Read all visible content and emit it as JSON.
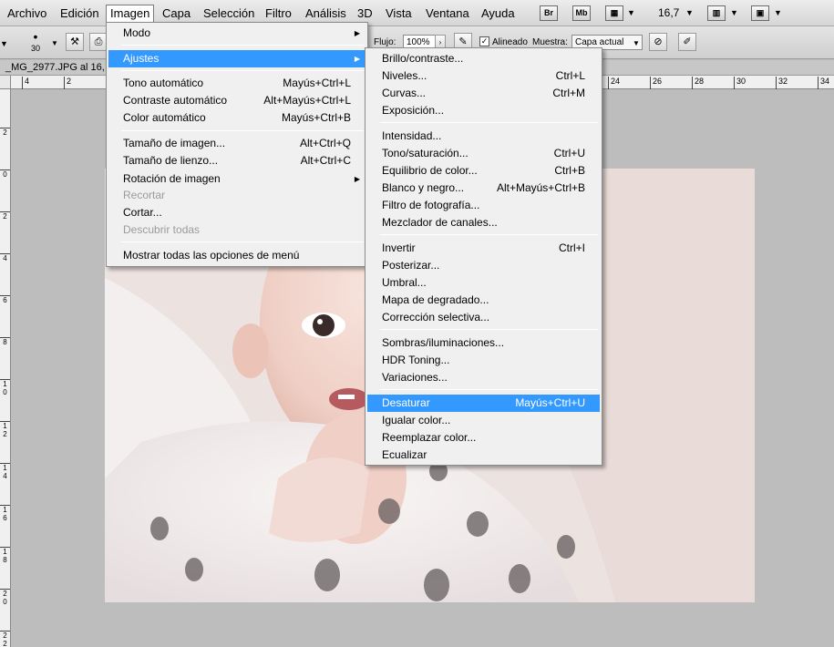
{
  "menubar": {
    "items": [
      "Archivo",
      "Edición",
      "Imagen",
      "Capa",
      "Selección",
      "Filtro",
      "Análisis",
      "3D",
      "Vista",
      "Ventana",
      "Ayuda"
    ],
    "bridge_label": "Br",
    "minibridge_label": "Mb",
    "zoom_value": "16,7"
  },
  "options": {
    "brush_size": "30",
    "flow_label": "Flujo:",
    "flow_value": "100%",
    "aligned_label": "Alineado",
    "sample_label": "Muestra:",
    "sample_value": "Capa actual"
  },
  "document": {
    "tab_title": "_MG_2977.JPG al 16,",
    "ruler_h": [
      "4",
      "2",
      "24",
      "26",
      "28",
      "30",
      "32",
      "34"
    ],
    "ruler_v": [
      "2",
      "0",
      "2",
      "4",
      "6",
      "8",
      "1 0",
      "1 2",
      "1 4",
      "1 6",
      "1 8",
      "2 0",
      "2 2"
    ]
  },
  "imagen_menu": {
    "items": [
      {
        "label": "Modo",
        "shortcut": "",
        "submenu": true
      },
      {
        "label": "Ajustes",
        "shortcut": "",
        "submenu": true
      },
      {
        "label": "Tono automático",
        "shortcut": "Mayús+Ctrl+L"
      },
      {
        "label": "Contraste automático",
        "shortcut": "Alt+Mayús+Ctrl+L"
      },
      {
        "label": "Color automático",
        "shortcut": "Mayús+Ctrl+B"
      },
      {
        "label": "Tamaño de imagen...",
        "shortcut": "Alt+Ctrl+Q"
      },
      {
        "label": "Tamaño de lienzo...",
        "shortcut": "Alt+Ctrl+C"
      },
      {
        "label": "Rotación de imagen",
        "shortcut": "",
        "submenu": true
      },
      {
        "label": "Recortar",
        "shortcut": ""
      },
      {
        "label": "Cortar...",
        "shortcut": ""
      },
      {
        "label": "Descubrir todas",
        "shortcut": ""
      },
      {
        "label": "Mostrar todas las opciones de menú",
        "shortcut": ""
      }
    ]
  },
  "ajustes_menu": {
    "items": [
      {
        "label": "Brillo/contraste...",
        "shortcut": ""
      },
      {
        "label": "Niveles...",
        "shortcut": "Ctrl+L"
      },
      {
        "label": "Curvas...",
        "shortcut": "Ctrl+M"
      },
      {
        "label": "Exposición...",
        "shortcut": ""
      },
      {
        "label": "Intensidad...",
        "shortcut": ""
      },
      {
        "label": "Tono/saturación...",
        "shortcut": "Ctrl+U"
      },
      {
        "label": "Equilibrio de color...",
        "shortcut": "Ctrl+B"
      },
      {
        "label": "Blanco y negro...",
        "shortcut": "Alt+Mayús+Ctrl+B"
      },
      {
        "label": "Filtro de fotografía...",
        "shortcut": ""
      },
      {
        "label": "Mezclador de canales...",
        "shortcut": ""
      },
      {
        "label": "Invertir",
        "shortcut": "Ctrl+I"
      },
      {
        "label": "Posterizar...",
        "shortcut": ""
      },
      {
        "label": "Umbral...",
        "shortcut": ""
      },
      {
        "label": "Mapa de degradado...",
        "shortcut": ""
      },
      {
        "label": "Corrección selectiva...",
        "shortcut": ""
      },
      {
        "label": "Sombras/iluminaciones...",
        "shortcut": ""
      },
      {
        "label": "HDR Toning...",
        "shortcut": ""
      },
      {
        "label": "Variaciones...",
        "shortcut": ""
      },
      {
        "label": "Desaturar",
        "shortcut": "Mayús+Ctrl+U"
      },
      {
        "label": "Igualar color...",
        "shortcut": ""
      },
      {
        "label": "Reemplazar color...",
        "shortcut": ""
      },
      {
        "label": "Ecualizar",
        "shortcut": ""
      }
    ]
  },
  "colors": {
    "highlight": "#3399ff",
    "menu_bg": "#f0f0f0",
    "disabled": "#9b9b9b"
  }
}
